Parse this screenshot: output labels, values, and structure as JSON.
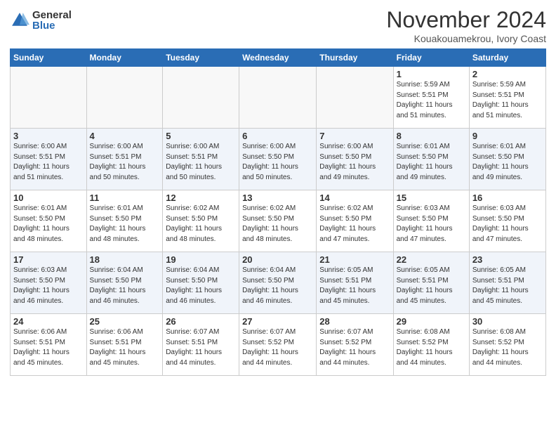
{
  "header": {
    "logo_general": "General",
    "logo_blue": "Blue",
    "month_title": "November 2024",
    "location": "Kouakouamekrou, Ivory Coast"
  },
  "weekdays": [
    "Sunday",
    "Monday",
    "Tuesday",
    "Wednesday",
    "Thursday",
    "Friday",
    "Saturday"
  ],
  "weeks": [
    [
      {
        "day": "",
        "info": ""
      },
      {
        "day": "",
        "info": ""
      },
      {
        "day": "",
        "info": ""
      },
      {
        "day": "",
        "info": ""
      },
      {
        "day": "",
        "info": ""
      },
      {
        "day": "1",
        "info": "Sunrise: 5:59 AM\nSunset: 5:51 PM\nDaylight: 11 hours\nand 51 minutes."
      },
      {
        "day": "2",
        "info": "Sunrise: 5:59 AM\nSunset: 5:51 PM\nDaylight: 11 hours\nand 51 minutes."
      }
    ],
    [
      {
        "day": "3",
        "info": "Sunrise: 6:00 AM\nSunset: 5:51 PM\nDaylight: 11 hours\nand 51 minutes."
      },
      {
        "day": "4",
        "info": "Sunrise: 6:00 AM\nSunset: 5:51 PM\nDaylight: 11 hours\nand 50 minutes."
      },
      {
        "day": "5",
        "info": "Sunrise: 6:00 AM\nSunset: 5:51 PM\nDaylight: 11 hours\nand 50 minutes."
      },
      {
        "day": "6",
        "info": "Sunrise: 6:00 AM\nSunset: 5:50 PM\nDaylight: 11 hours\nand 50 minutes."
      },
      {
        "day": "7",
        "info": "Sunrise: 6:00 AM\nSunset: 5:50 PM\nDaylight: 11 hours\nand 49 minutes."
      },
      {
        "day": "8",
        "info": "Sunrise: 6:01 AM\nSunset: 5:50 PM\nDaylight: 11 hours\nand 49 minutes."
      },
      {
        "day": "9",
        "info": "Sunrise: 6:01 AM\nSunset: 5:50 PM\nDaylight: 11 hours\nand 49 minutes."
      }
    ],
    [
      {
        "day": "10",
        "info": "Sunrise: 6:01 AM\nSunset: 5:50 PM\nDaylight: 11 hours\nand 48 minutes."
      },
      {
        "day": "11",
        "info": "Sunrise: 6:01 AM\nSunset: 5:50 PM\nDaylight: 11 hours\nand 48 minutes."
      },
      {
        "day": "12",
        "info": "Sunrise: 6:02 AM\nSunset: 5:50 PM\nDaylight: 11 hours\nand 48 minutes."
      },
      {
        "day": "13",
        "info": "Sunrise: 6:02 AM\nSunset: 5:50 PM\nDaylight: 11 hours\nand 48 minutes."
      },
      {
        "day": "14",
        "info": "Sunrise: 6:02 AM\nSunset: 5:50 PM\nDaylight: 11 hours\nand 47 minutes."
      },
      {
        "day": "15",
        "info": "Sunrise: 6:03 AM\nSunset: 5:50 PM\nDaylight: 11 hours\nand 47 minutes."
      },
      {
        "day": "16",
        "info": "Sunrise: 6:03 AM\nSunset: 5:50 PM\nDaylight: 11 hours\nand 47 minutes."
      }
    ],
    [
      {
        "day": "17",
        "info": "Sunrise: 6:03 AM\nSunset: 5:50 PM\nDaylight: 11 hours\nand 46 minutes."
      },
      {
        "day": "18",
        "info": "Sunrise: 6:04 AM\nSunset: 5:50 PM\nDaylight: 11 hours\nand 46 minutes."
      },
      {
        "day": "19",
        "info": "Sunrise: 6:04 AM\nSunset: 5:50 PM\nDaylight: 11 hours\nand 46 minutes."
      },
      {
        "day": "20",
        "info": "Sunrise: 6:04 AM\nSunset: 5:50 PM\nDaylight: 11 hours\nand 46 minutes."
      },
      {
        "day": "21",
        "info": "Sunrise: 6:05 AM\nSunset: 5:51 PM\nDaylight: 11 hours\nand 45 minutes."
      },
      {
        "day": "22",
        "info": "Sunrise: 6:05 AM\nSunset: 5:51 PM\nDaylight: 11 hours\nand 45 minutes."
      },
      {
        "day": "23",
        "info": "Sunrise: 6:05 AM\nSunset: 5:51 PM\nDaylight: 11 hours\nand 45 minutes."
      }
    ],
    [
      {
        "day": "24",
        "info": "Sunrise: 6:06 AM\nSunset: 5:51 PM\nDaylight: 11 hours\nand 45 minutes."
      },
      {
        "day": "25",
        "info": "Sunrise: 6:06 AM\nSunset: 5:51 PM\nDaylight: 11 hours\nand 45 minutes."
      },
      {
        "day": "26",
        "info": "Sunrise: 6:07 AM\nSunset: 5:51 PM\nDaylight: 11 hours\nand 44 minutes."
      },
      {
        "day": "27",
        "info": "Sunrise: 6:07 AM\nSunset: 5:52 PM\nDaylight: 11 hours\nand 44 minutes."
      },
      {
        "day": "28",
        "info": "Sunrise: 6:07 AM\nSunset: 5:52 PM\nDaylight: 11 hours\nand 44 minutes."
      },
      {
        "day": "29",
        "info": "Sunrise: 6:08 AM\nSunset: 5:52 PM\nDaylight: 11 hours\nand 44 minutes."
      },
      {
        "day": "30",
        "info": "Sunrise: 6:08 AM\nSunset: 5:52 PM\nDaylight: 11 hours\nand 44 minutes."
      }
    ]
  ]
}
